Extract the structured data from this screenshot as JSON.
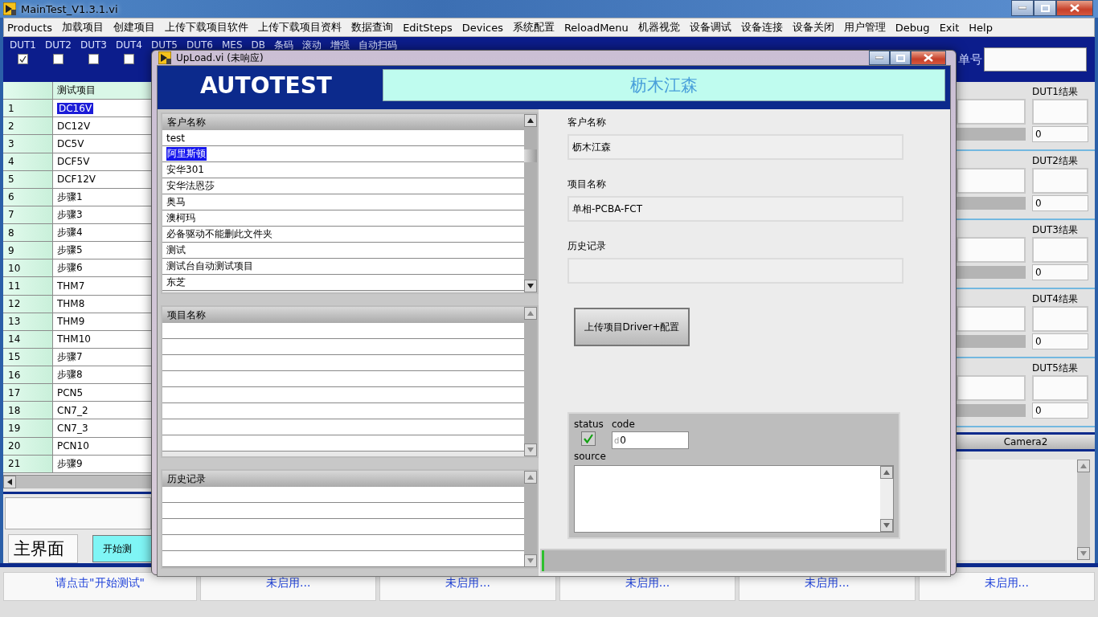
{
  "main_window": {
    "title": "MainTest_V1.3.1.vi"
  },
  "menu": [
    "Products",
    "加载项目",
    "创建项目",
    "上传下载项目软件",
    "上传下载项目资料",
    "数据查询",
    "EditSteps",
    "Devices",
    "系统配置",
    "ReloadMenu",
    "机器视觉",
    "设备调试",
    "设备连接",
    "设备关闭",
    "用户管理",
    "Debug",
    "Exit",
    "Help"
  ],
  "options": [
    {
      "label": "DUT1",
      "checked": true
    },
    {
      "label": "DUT2",
      "checked": false
    },
    {
      "label": "DUT3",
      "checked": false
    },
    {
      "label": "DUT4",
      "checked": false
    },
    {
      "label": "DUT5"
    },
    {
      "label": "DUT6"
    },
    {
      "label": "MES"
    },
    {
      "label": "DB"
    },
    {
      "label": "条码"
    },
    {
      "label": "滚动"
    },
    {
      "label": "增强"
    },
    {
      "label": "自动扫码"
    }
  ],
  "order_label": "单号",
  "test_table": {
    "column": "测试项目",
    "rows": [
      {
        "index": "1",
        "item": "DC16V",
        "selected": true
      },
      {
        "index": "2",
        "item": "DC12V",
        "selected": false
      },
      {
        "index": "3",
        "item": "DC5V",
        "selected": false
      },
      {
        "index": "4",
        "item": "DCF5V",
        "selected": false
      },
      {
        "index": "5",
        "item": "DCF12V",
        "selected": false
      },
      {
        "index": "6",
        "item": "步骤1",
        "selected": false
      },
      {
        "index": "7",
        "item": "步骤3",
        "selected": false
      },
      {
        "index": "8",
        "item": "步骤4",
        "selected": false
      },
      {
        "index": "9",
        "item": "步骤5",
        "selected": false
      },
      {
        "index": "10",
        "item": "步骤6",
        "selected": false
      },
      {
        "index": "11",
        "item": "THM7",
        "selected": false
      },
      {
        "index": "12",
        "item": "THM8",
        "selected": false
      },
      {
        "index": "13",
        "item": "THM9",
        "selected": false
      },
      {
        "index": "14",
        "item": "THM10",
        "selected": false
      },
      {
        "index": "15",
        "item": "步骤7",
        "selected": false
      },
      {
        "index": "16",
        "item": "步骤8",
        "selected": false
      },
      {
        "index": "17",
        "item": "PCN5",
        "selected": false
      },
      {
        "index": "18",
        "item": "CN7_2",
        "selected": false
      },
      {
        "index": "19",
        "item": "CN7_3",
        "selected": false
      },
      {
        "index": "20",
        "item": "PCN10",
        "selected": false
      },
      {
        "index": "21",
        "item": "步骤9",
        "selected": false
      }
    ]
  },
  "page_label": "主界面",
  "start_button": "开始测",
  "dut_results": [
    {
      "label": "DUT1结果",
      "count": "0"
    },
    {
      "label": "DUT2结果",
      "count": "0"
    },
    {
      "label": "DUT3结果",
      "count": "0"
    },
    {
      "label": "DUT4结果",
      "count": "0"
    },
    {
      "label": "DUT5结果",
      "count": "0"
    }
  ],
  "camera_tab": "Camera2",
  "status_cells": [
    "请点击\"开始测试\"",
    "未启用...",
    "未启用...",
    "未启用...",
    "未启用...",
    "未启用..."
  ],
  "dialog": {
    "title": "UpLoad.vi (未响应)",
    "brand": "AUTOTEST",
    "banner": "枥木江森",
    "customer_list": {
      "header": "客户名称",
      "items": [
        {
          "text": "test",
          "selected": false
        },
        {
          "text": "阿里斯顿",
          "selected": true
        },
        {
          "text": "安华301",
          "selected": false
        },
        {
          "text": "安华法恩莎",
          "selected": false
        },
        {
          "text": "奥马",
          "selected": false
        },
        {
          "text": "澳柯玛",
          "selected": false
        },
        {
          "text": "必备驱动不能删此文件夹",
          "selected": false
        },
        {
          "text": "测试",
          "selected": false
        },
        {
          "text": "测试台自动测试项目",
          "selected": false
        },
        {
          "text": "东芝",
          "selected": false
        }
      ]
    },
    "project_list": {
      "header": "项目名称"
    },
    "history_list": {
      "header": "历史记录"
    },
    "fields": [
      {
        "label": "客户名称",
        "value": "枥木江森"
      },
      {
        "label": "项目名称",
        "value": "单相-PCBA-FCT"
      },
      {
        "label": "历史记录"
      }
    ],
    "upload_button": "上传项目Driver+配置",
    "error_cluster": {
      "status_label": "status",
      "status": true,
      "code_label": "code",
      "code_radix": "d",
      "code": "0",
      "source_label": "source"
    },
    "progress": {
      "level": 0.006
    }
  }
}
